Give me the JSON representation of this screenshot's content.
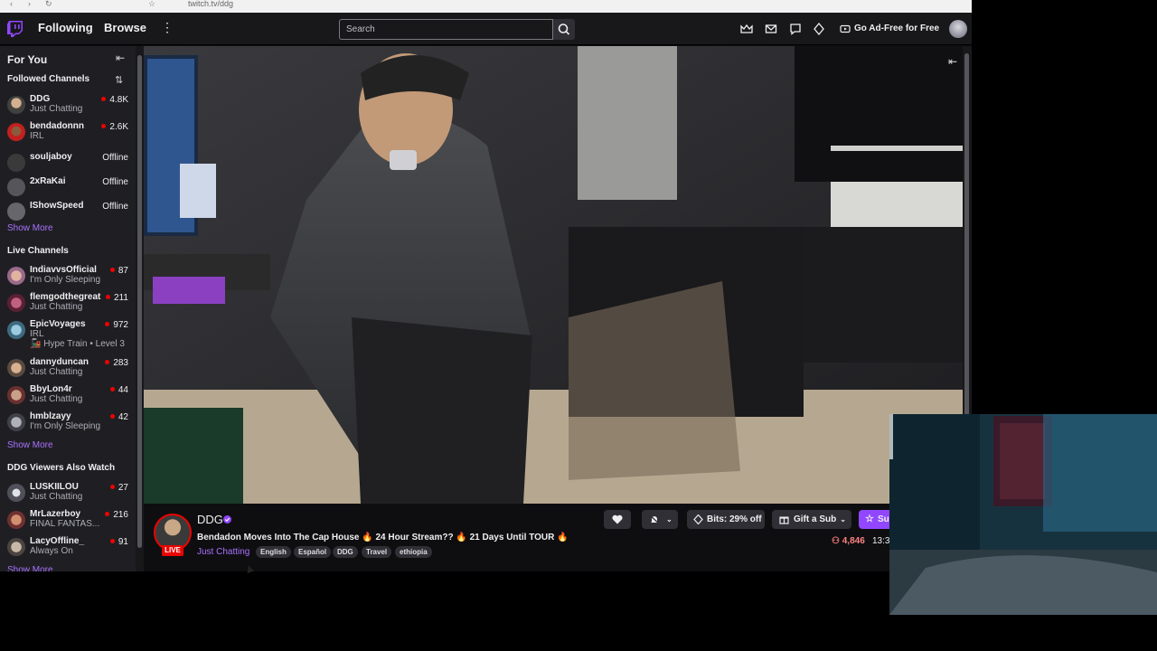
{
  "browser": {
    "url": "twitch.tv/ddg"
  },
  "topnav": {
    "following": "Following",
    "browse": "Browse",
    "search_placeholder": "Search",
    "ad_free": "Go Ad-Free for Free"
  },
  "sidebar": {
    "title": "For You",
    "followed_header": "Followed Channels",
    "followed": [
      {
        "name": "DDG",
        "category": "Just Chatting",
        "viewers": "4.8K"
      },
      {
        "name": "bendadonnn",
        "category": "IRL",
        "viewers": "2.6K"
      },
      {
        "name": "souljaboy",
        "status": "Offline"
      },
      {
        "name": "2xRaKai",
        "status": "Offline"
      },
      {
        "name": "IShowSpeed",
        "status": "Offline"
      }
    ],
    "show_more": "Show More",
    "live_header": "Live Channels",
    "live": [
      {
        "name": "IndiavvsOfficial",
        "category": "I'm Only Sleeping",
        "viewers": "87"
      },
      {
        "name": "flemgodthegreat",
        "category": "Just Chatting",
        "viewers": "211"
      },
      {
        "name": "EpicVoyages",
        "category": "IRL",
        "viewers": "972",
        "hype": "Hype Train • Level 3"
      },
      {
        "name": "dannyduncan",
        "category": "Just Chatting",
        "viewers": "283"
      },
      {
        "name": "BbyLon4r",
        "category": "Just Chatting",
        "viewers": "44"
      },
      {
        "name": "hmblzayy",
        "category": "I'm Only Sleeping",
        "viewers": "42"
      }
    ],
    "also_header": "DDG Viewers Also Watch",
    "also": [
      {
        "name": "LUSKIILOU",
        "category": "Just Chatting",
        "viewers": "27"
      },
      {
        "name": "MrLazerboy",
        "category": "FINAL FANTAS...",
        "viewers": "216"
      },
      {
        "name": "LacyOffline_",
        "category": "Always On",
        "viewers": "91"
      }
    ]
  },
  "stream": {
    "channel": "DDG",
    "live_label": "LIVE",
    "title": "Bendadon Moves Into The Cap House 🔥 24 Hour Stream?? 🔥 21 Days Until TOUR 🔥",
    "category": "Just Chatting",
    "tags": [
      "English",
      "Español",
      "DDG",
      "Travel",
      "ethiopia"
    ],
    "bits": "Bits: 29% off",
    "gift": "Gift a Sub",
    "subscribe": "Su",
    "viewers": "4,846",
    "uptime": "13:3"
  },
  "colors": {
    "accent": "#9147ff",
    "live": "#eb0400",
    "link": "#a970ff"
  }
}
